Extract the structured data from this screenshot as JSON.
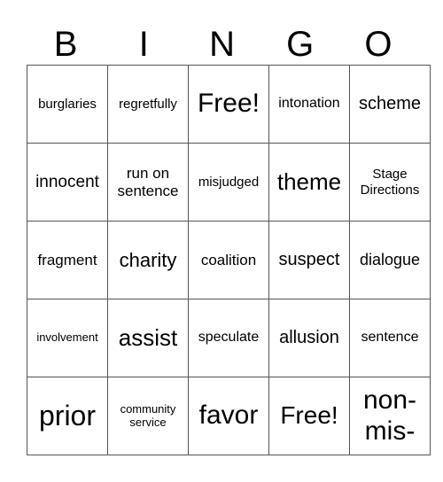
{
  "header": [
    "B",
    "I",
    "N",
    "G",
    "O"
  ],
  "board": [
    [
      "burglaries",
      "regretfully",
      "Free!",
      "intonation",
      "scheme"
    ],
    [
      "innocent",
      "run on sentence",
      "misjudged",
      "theme",
      "Stage Directions"
    ],
    [
      "fragment",
      "charity",
      "coalition",
      "suspect",
      "dialogue"
    ],
    [
      "involvement",
      "assist",
      "speculate",
      "allusion",
      "sentence"
    ],
    [
      "prior",
      "community service",
      "favor",
      "Free!",
      "non-mis-"
    ]
  ]
}
